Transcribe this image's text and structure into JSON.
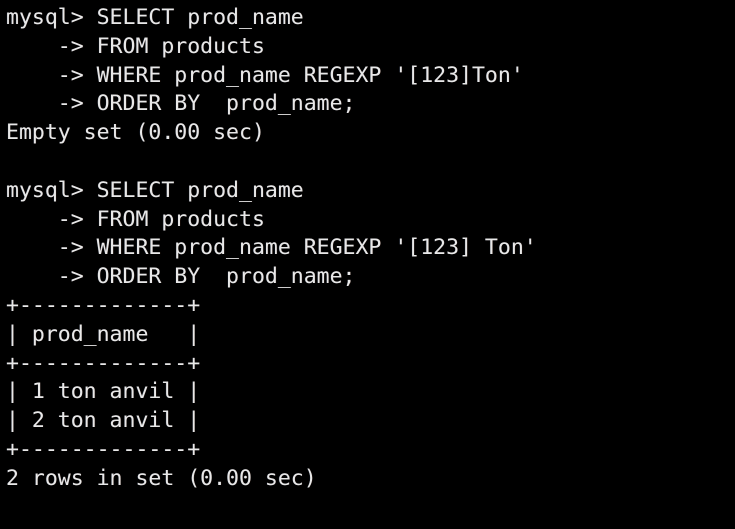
{
  "terminal": {
    "app": "mysql-client",
    "background_color": "#000000",
    "text_color": "#e8e8e8",
    "prompt": "mysql>",
    "continuation_prompt": "->",
    "lines": [
      {
        "id": "q1-l1",
        "kind": "prompt",
        "text": "mysql> SELECT prod_name"
      },
      {
        "id": "q1-l2",
        "kind": "continuation",
        "text": "    -> FROM products"
      },
      {
        "id": "q1-l3",
        "kind": "continuation",
        "text": "    -> WHERE prod_name REGEXP '[123]Ton'"
      },
      {
        "id": "q1-l4",
        "kind": "continuation",
        "text": "    -> ORDER BY  prod_name;"
      },
      {
        "id": "q1-result",
        "kind": "status",
        "text": "Empty set (0.00 sec)"
      },
      {
        "id": "spacer-1",
        "kind": "blank",
        "text": ""
      },
      {
        "id": "q2-l1",
        "kind": "prompt",
        "text": "mysql> SELECT prod_name"
      },
      {
        "id": "q2-l2",
        "kind": "continuation",
        "text": "    -> FROM products"
      },
      {
        "id": "q2-l3",
        "kind": "continuation",
        "text": "    -> WHERE prod_name REGEXP '[123] Ton'"
      },
      {
        "id": "q2-l4",
        "kind": "continuation",
        "text": "    -> ORDER BY  prod_name;"
      },
      {
        "id": "t-top",
        "kind": "table-rule",
        "text": "+-------------+"
      },
      {
        "id": "t-header",
        "kind": "table-header",
        "text": "| prod_name   |"
      },
      {
        "id": "t-mid",
        "kind": "table-rule",
        "text": "+-------------+"
      },
      {
        "id": "t-row-1",
        "kind": "table-row",
        "text": "| 1 ton anvil |"
      },
      {
        "id": "t-row-2",
        "kind": "table-row",
        "text": "| 2 ton anvil |"
      },
      {
        "id": "t-bottom",
        "kind": "table-rule",
        "text": "+-------------+"
      },
      {
        "id": "q2-result",
        "kind": "status",
        "text": "2 rows in set (0.00 sec)"
      }
    ]
  },
  "queries": [
    {
      "sql": "SELECT prod_name FROM products WHERE prod_name REGEXP '[123]Ton' ORDER BY  prod_name;",
      "select_clause": "SELECT prod_name",
      "from_clause": "FROM products",
      "where_clause": "WHERE prod_name REGEXP '[123]Ton'",
      "order_by_clause": "ORDER BY  prod_name;",
      "pattern": "[123]Ton",
      "result_status": "Empty set (0.00 sec)",
      "row_count": 0,
      "elapsed": "0.00 sec"
    },
    {
      "sql": "SELECT prod_name FROM products WHERE prod_name REGEXP '[123] Ton' ORDER BY  prod_name;",
      "select_clause": "SELECT prod_name",
      "from_clause": "FROM products",
      "where_clause": "WHERE prod_name REGEXP '[123] Ton'",
      "order_by_clause": "ORDER BY  prod_name;",
      "pattern": "[123] Ton",
      "result_status": "2 rows in set (0.00 sec)",
      "row_count": 2,
      "elapsed": "0.00 sec",
      "result_table": {
        "columns": [
          "prod_name"
        ],
        "rows": [
          [
            "1 ton anvil"
          ],
          [
            "2 ton anvil"
          ]
        ]
      }
    }
  ]
}
